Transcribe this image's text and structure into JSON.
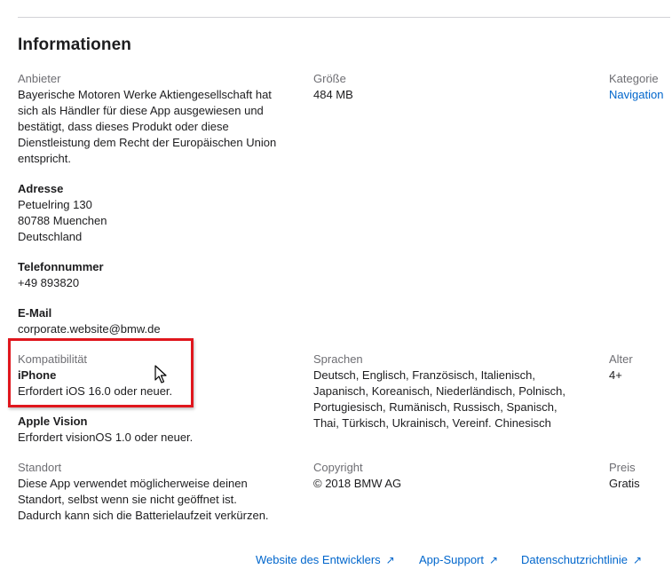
{
  "section": {
    "title": "Informationen"
  },
  "provider": {
    "label": "Anbieter",
    "value": "Bayerische Motoren Werke Aktiengesellschaft hat\nsich als Händler für diese App ausgewiesen und\nbestätigt, dass dieses Produkt oder diese\nDienstleistung dem Recht der Europäischen Union\nentspricht."
  },
  "address": {
    "label": "Adresse",
    "value": "Petuelring 130\n80788 Muenchen\nDeutschland"
  },
  "phone": {
    "label": "Telefonnummer",
    "value": "+49 893820"
  },
  "email": {
    "label": "E-Mail",
    "value": "corporate.website@bmw.de"
  },
  "size": {
    "label": "Größe",
    "value": "484 MB"
  },
  "category": {
    "label": "Kategorie",
    "value": "Navigation"
  },
  "compatibility": {
    "label": "Kompatibilität",
    "iphone_title": "iPhone",
    "iphone_req": "Erfordert iOS 16.0 oder neuer.",
    "vision_title": "Apple Vision",
    "vision_req": "Erfordert visionOS 1.0 oder neuer."
  },
  "languages": {
    "label": "Sprachen",
    "value": "Deutsch, Englisch, Französisch, Italienisch,\nJapanisch, Koreanisch, Niederländisch, Polnisch,\nPortugiesisch, Rumänisch, Russisch, Spanisch,\nThai, Türkisch, Ukrainisch, Vereinf. Chinesisch"
  },
  "age": {
    "label": "Alter",
    "value": "4+"
  },
  "location": {
    "label": "Standort",
    "value": "Diese App verwendet möglicherweise deinen\nStandort, selbst wenn sie nicht geöffnet ist.\nDadurch kann sich die Batterielaufzeit verkürzen."
  },
  "copyright": {
    "label": "Copyright",
    "value": "© 2018 BMW AG"
  },
  "price": {
    "label": "Preis",
    "value": "Gratis"
  },
  "footer": {
    "developer_site": "Website des Entwicklers",
    "app_support": "App-Support",
    "privacy_policy": "Datenschutzrichtlinie",
    "arrow_glyph": "↗"
  },
  "colors": {
    "link": "#0066cc",
    "highlight": "#e0161d",
    "label": "#6e6e73",
    "text": "#1d1d1f"
  },
  "icons": {
    "cursor": "mouse-pointer-icon",
    "external": "external-link-arrow-icon"
  }
}
